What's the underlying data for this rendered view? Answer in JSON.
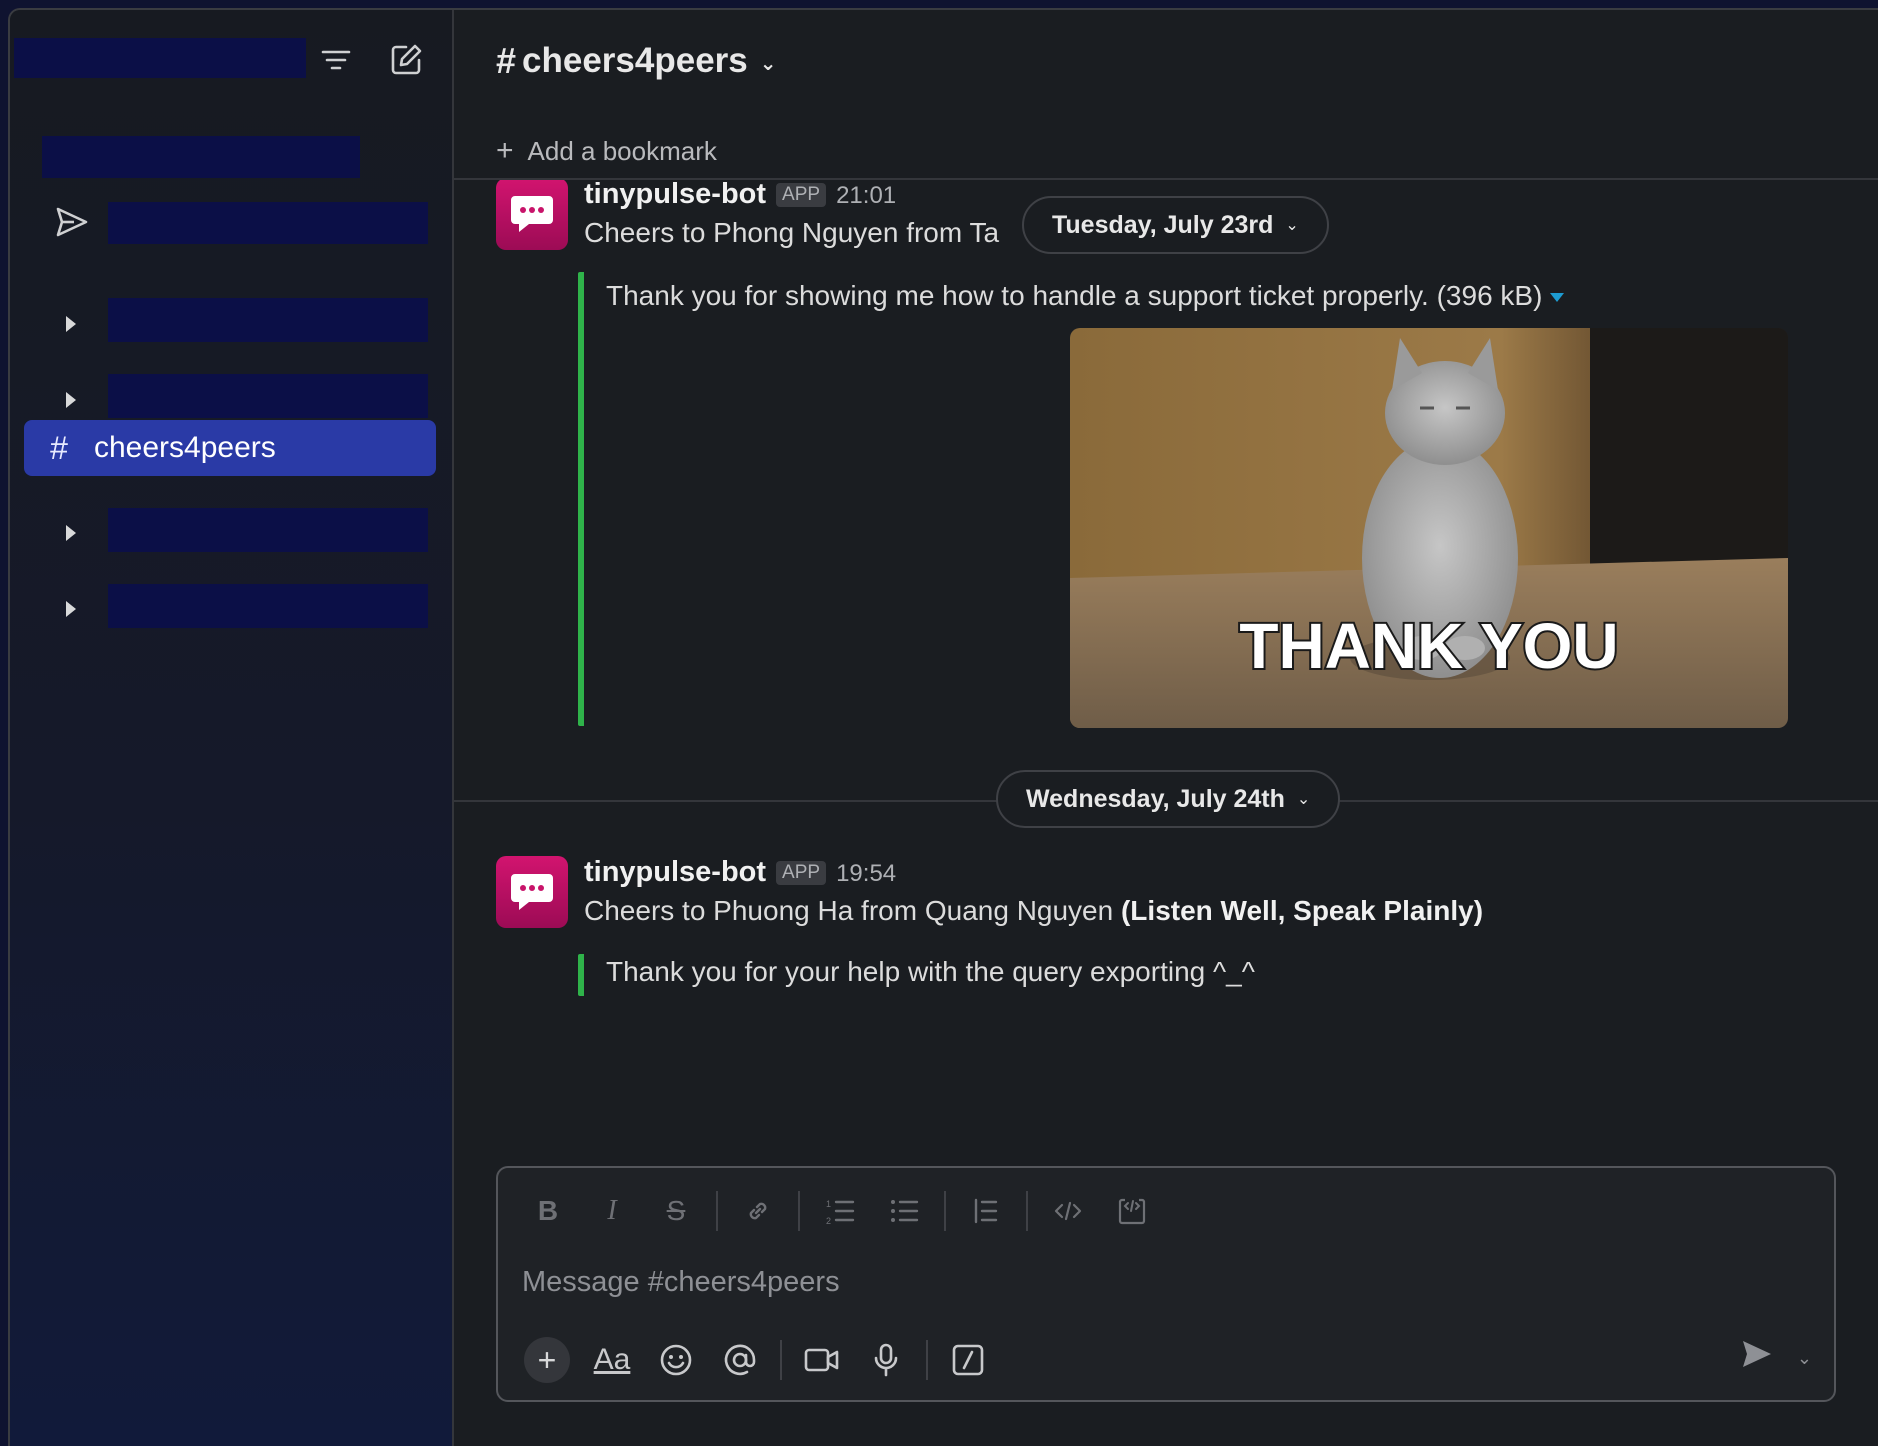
{
  "sidebar": {
    "active_channel_hash": "#",
    "active_channel": "cheers4peers"
  },
  "channel": {
    "hash": "#",
    "name": "cheers4peers",
    "bookmark_label": "Add a bookmark"
  },
  "messages": [
    {
      "author": "tinypulse-bot",
      "badge": "APP",
      "time": "21:01",
      "text": "Cheers to Phong Nguyen from Ta",
      "quote": "Thank you for showing me how to handle a support ticket properly. (396 kB)",
      "image_caption": "THANK YOU"
    },
    {
      "author": "tinypulse-bot",
      "badge": "APP",
      "time": "19:54",
      "text": "Cheers to Phuong Ha from Quang Nguyen ",
      "text_bold": "(Listen Well, Speak Plainly)",
      "quote": "Thank you for your help with the query exporting ^_^"
    }
  ],
  "date_dividers": [
    "Tuesday, July 23rd",
    "Wednesday, July 24th"
  ],
  "composer": {
    "placeholder": "Message #cheers4peers",
    "format_label": "Aa"
  },
  "colors": {
    "active_channel_bg": "#2a3aa6",
    "quote_bar": "#2fb34a",
    "avatar": "#c8146a",
    "redaction": "#0b0f47"
  }
}
